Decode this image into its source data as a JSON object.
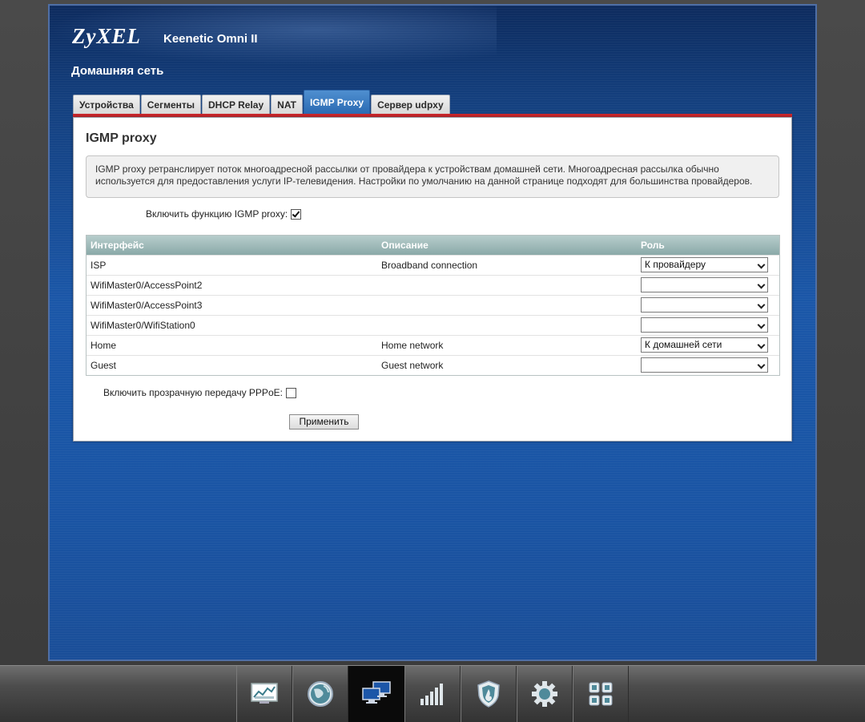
{
  "header": {
    "logo": "ZyXEL",
    "model": "Keenetic Omni II",
    "section_title": "Домашняя сеть"
  },
  "tabs": [
    {
      "label": "Устройства",
      "active": false
    },
    {
      "label": "Сегменты",
      "active": false
    },
    {
      "label": "DHCP Relay",
      "active": false
    },
    {
      "label": "NAT",
      "active": false
    },
    {
      "label": "IGMP Proxy",
      "active": true
    },
    {
      "label": "Сервер udpxy",
      "active": false
    }
  ],
  "panel": {
    "heading": "IGMP proxy",
    "info_text": "IGMP proxy ретранслирует поток многоадресной рассылки от провайдера к устройствам домашней сети. Многоадресная рассылка обычно используется для предоставления услуги IP-телевидения. Настройки по умолчанию на данной странице подходят для большинства провайдеров.",
    "enable_label": "Включить функцию IGMP proxy:",
    "enable_checked": true,
    "table": {
      "headers": {
        "interface": "Интерфейс",
        "description": "Описание",
        "role": "Роль"
      },
      "rows": [
        {
          "interface": "ISP",
          "description": "Broadband connection",
          "role": "К провайдеру"
        },
        {
          "interface": "WifiMaster0/AccessPoint2",
          "description": "",
          "role": ""
        },
        {
          "interface": "WifiMaster0/AccessPoint3",
          "description": "",
          "role": ""
        },
        {
          "interface": "WifiMaster0/WifiStation0",
          "description": "",
          "role": ""
        },
        {
          "interface": "Home",
          "description": "Home network",
          "role": "К домашней сети"
        },
        {
          "interface": "Guest",
          "description": "Guest network",
          "role": ""
        }
      ]
    },
    "pppoe_label": "Включить прозрачную передачу PPPoE:",
    "pppoe_checked": false,
    "apply_label": "Применить"
  },
  "bottom_nav": [
    {
      "icon": "monitor-chart-icon",
      "active": false
    },
    {
      "icon": "globe-icon",
      "active": false
    },
    {
      "icon": "home-network-icon",
      "active": true
    },
    {
      "icon": "wifi-signal-icon",
      "active": false
    },
    {
      "icon": "firewall-shield-icon",
      "active": false
    },
    {
      "icon": "gear-icon",
      "active": false
    },
    {
      "icon": "apps-grid-icon",
      "active": false
    }
  ],
  "colors": {
    "accent_red": "#c9262c",
    "tab_active": "#2a6ab3",
    "page_blue": "#1b57a8",
    "table_header": "#8aa9a8"
  }
}
